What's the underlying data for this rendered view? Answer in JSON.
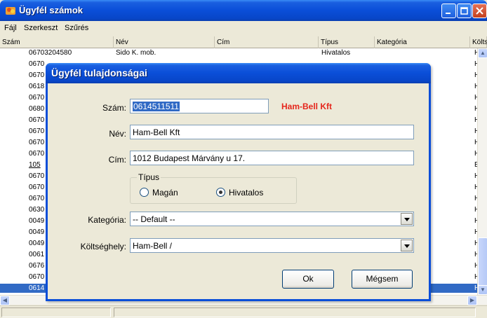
{
  "main": {
    "title": "Ügyfél számok",
    "menu": [
      {
        "label": "Fájl"
      },
      {
        "label": "Szerkeszt"
      },
      {
        "label": "Szűrés"
      }
    ],
    "columns": [
      "Szám",
      "Név",
      "Cím",
      "Típus",
      "Kategória",
      "Költs"
    ],
    "rows": [
      {
        "szam": "06703204580",
        "nev": "Sido K. mob.",
        "tipus": "Hivatalos",
        "koltseg": "H"
      },
      {
        "szam": "0670",
        "koltseg": "H"
      },
      {
        "szam": "0670",
        "koltseg": "H"
      },
      {
        "szam": "0618",
        "koltseg": "H"
      },
      {
        "szam": "0670",
        "koltseg": "H"
      },
      {
        "szam": "0680",
        "koltseg": "H"
      },
      {
        "szam": "0670",
        "koltseg": "H"
      },
      {
        "szam": "0670",
        "koltseg": "H"
      },
      {
        "szam": "0670",
        "koltseg": "H"
      },
      {
        "szam": "0670",
        "koltseg": "H"
      },
      {
        "szam": "105",
        "koltseg": "E"
      },
      {
        "szam": "0670",
        "koltseg": "H"
      },
      {
        "szam": "0670",
        "koltseg": "H"
      },
      {
        "szam": "0670",
        "koltseg": "H"
      },
      {
        "szam": "0630",
        "koltseg": "H"
      },
      {
        "szam": "0049",
        "koltseg": "H"
      },
      {
        "szam": "0049",
        "koltseg": "H"
      },
      {
        "szam": "0049",
        "koltseg": "H"
      },
      {
        "szam": "0061",
        "koltseg": "H"
      },
      {
        "szam": "0676",
        "koltseg": "H"
      },
      {
        "szam": "0670",
        "koltseg": "H"
      },
      {
        "szam": "0614",
        "koltseg": "H",
        "selected": true
      }
    ]
  },
  "dialog": {
    "title": "Ügyfél tulajdonságai",
    "szam_label": "Szám:",
    "szam_value": "0614511511",
    "name_display": "Ham-Bell Kft",
    "nev_label": "Név:",
    "nev_value": "Ham-Bell Kft",
    "cim_label": "Cím:",
    "cim_value": "1012 Budapest Márvány u 17.",
    "tipus_legend": "Típus",
    "tipus_options": [
      "Magán",
      "Hivatalos"
    ],
    "tipus_selected": "Hivatalos",
    "kategoria_label": "Kategória:",
    "kategoria_value": "-- Default --",
    "koltseghely_label": "Költséghely:",
    "koltseghely_value": "Ham-Bell /",
    "ok_label": "Ok",
    "cancel_label": "Mégsem"
  },
  "colors": {
    "titlebar": "#0a4ed8",
    "selection": "#316ac5",
    "highlight_text": "#e5261c"
  }
}
